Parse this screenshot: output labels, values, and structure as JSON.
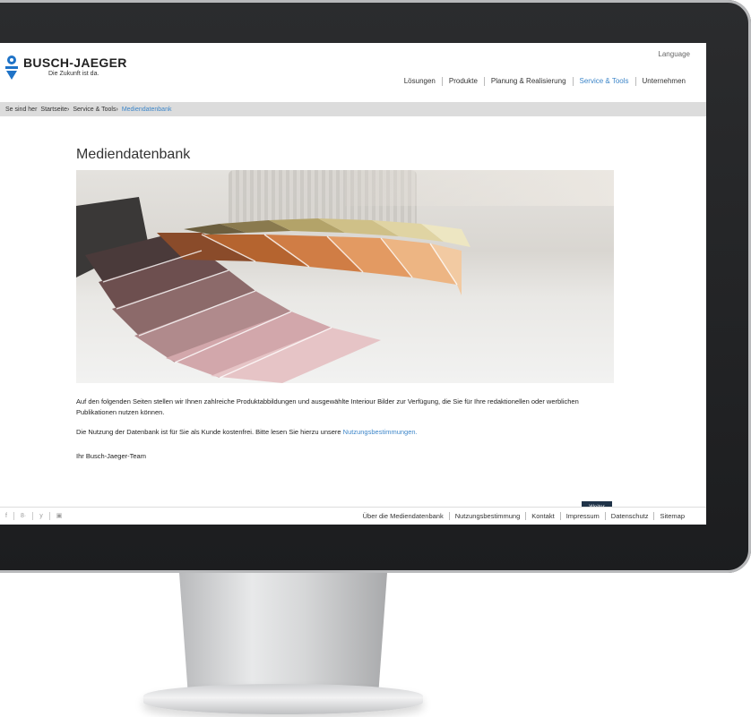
{
  "header": {
    "logo_name": "BUSCH-JAEGER",
    "logo_tagline": "Die Zukunft ist da.",
    "language": "Language",
    "nav": [
      {
        "label": "Lösungen"
      },
      {
        "label": "Produkte"
      },
      {
        "label": "Planung & Realisierung"
      },
      {
        "label": "Service & Tools"
      },
      {
        "label": "Unternehmen"
      }
    ]
  },
  "breadcrumb": {
    "prefix": "Se sind her",
    "items": [
      "Startseite",
      "Service & Tools",
      "Mediendatenbank"
    ],
    "separator": "›"
  },
  "main": {
    "title": "Mediendatenbank",
    "paragraph1": "Auf den folgenden Seiten stellen wir Ihnen zahlreiche Produktabbildungen und ausgewählte Interiour Bilder zur Verfügung, die Sie für Ihre redaktionellen oder werblichen Publikationen nutzen können.",
    "paragraph2_text": "Die Nutzung der Datenbank ist für Sie als Kunde kostenfrei. Bitte lesen Sie hierzu unsere ",
    "paragraph2_link": "Nutzungsbestimmungen.",
    "signature": "Ihr Busch-Jaeger-Team",
    "button_label": "Weiter"
  },
  "footer": {
    "social": [
      {
        "icon": "facebook-icon",
        "glyph": "f"
      },
      {
        "icon": "google-plus-icon",
        "glyph": "8·"
      },
      {
        "icon": "twitter-icon",
        "glyph": "y"
      },
      {
        "icon": "youtube-icon",
        "glyph": "▣"
      }
    ],
    "links": [
      {
        "label": "Über die Mediendatenbank"
      },
      {
        "label": "Nutzungsbestimmung"
      },
      {
        "label": "Kontakt"
      },
      {
        "label": "Impressum"
      },
      {
        "label": "Datenschutz"
      },
      {
        "label": "Sitemap"
      }
    ]
  },
  "colors": {
    "accent": "#3d86c9",
    "brand_blue": "#1f73c7",
    "button": "#1f3348",
    "breadcrumb_bg": "#dcdcdc"
  }
}
